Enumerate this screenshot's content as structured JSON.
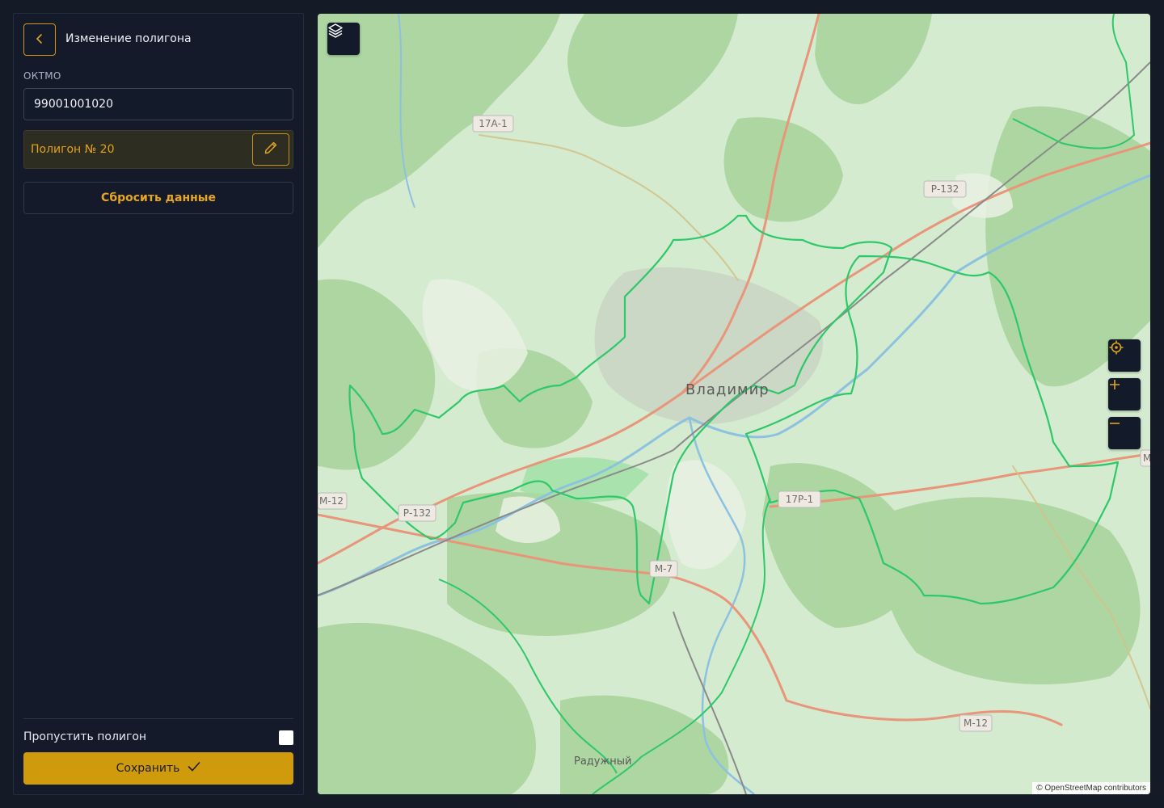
{
  "panel": {
    "title": "Изменение полигона",
    "oktmo_label": "ОКТМО",
    "oktmo_value": "99001001020",
    "polygon_name": "Полигон № 20",
    "reset_label": "Сбросить данные",
    "skip_label": "Пропустить полигон",
    "skip_checked": false,
    "save_label": "Сохранить"
  },
  "map": {
    "city_label": "Владимир",
    "town_label": "Радужный",
    "road_labels": [
      "17А-1",
      "Р-132",
      "М-12",
      "Р-132",
      "17Р-1",
      "М-7",
      "М-12",
      "М"
    ],
    "attribution": "© OpenStreetMap contributors"
  },
  "colors": {
    "accent": "#cf9a0c",
    "panel_bg": "#141a2a",
    "page_bg": "#151a27",
    "polygon_stroke": "#2ec86a"
  },
  "icons": {
    "back": "chevron-left-icon",
    "edit": "pencil-icon",
    "save": "check-icon",
    "layers": "layers-icon",
    "locate": "crosshair-icon",
    "zoom_in": "plus-icon",
    "zoom_out": "minus-icon"
  }
}
